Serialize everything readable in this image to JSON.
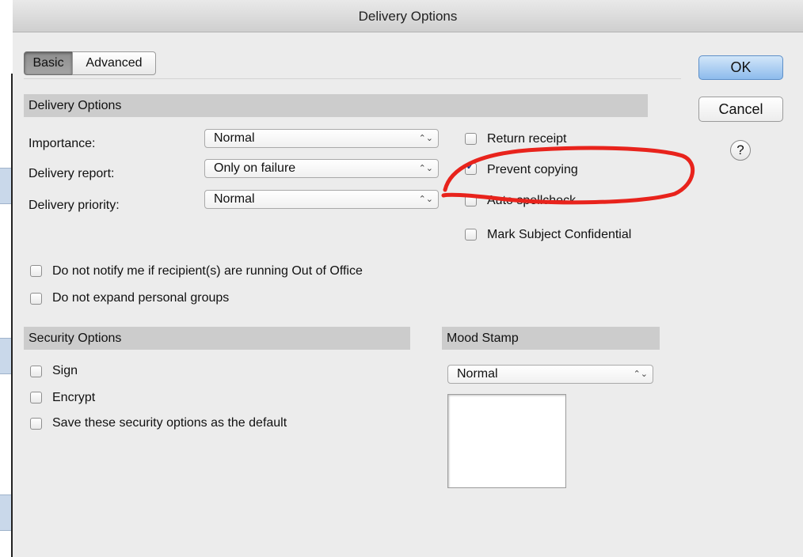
{
  "window": {
    "title": "Delivery Options"
  },
  "tabs": [
    {
      "label": "Basic",
      "selected": true
    },
    {
      "label": "Advanced",
      "selected": false
    }
  ],
  "buttons": {
    "ok": "OK",
    "cancel": "Cancel",
    "help": "?"
  },
  "delivery_section": {
    "header": "Delivery Options",
    "importance_label": "Importance:",
    "importance_value": "Normal",
    "report_label": "Delivery report:",
    "report_value": "Only on failure",
    "priority_label": "Delivery priority:",
    "priority_value": "Normal",
    "popup_arrows": "⌃⌄"
  },
  "right_checks": [
    {
      "label": "Return receipt",
      "checked": false
    },
    {
      "label": "Prevent copying",
      "checked": true
    },
    {
      "label": "Auto spellcheck",
      "checked": false
    },
    {
      "label": "Mark Subject Confidential",
      "checked": false
    }
  ],
  "wide_checks": [
    {
      "label": "Do not notify me if recipient(s) are running Out of Office",
      "checked": false
    },
    {
      "label": "Do not expand personal groups",
      "checked": false
    }
  ],
  "security_section": {
    "header": "Security Options",
    "items": [
      {
        "label": "Sign",
        "checked": false
      },
      {
        "label": "Encrypt",
        "checked": false
      },
      {
        "label": "Save these security options as the default",
        "checked": false
      }
    ]
  },
  "mood_section": {
    "header": "Mood Stamp",
    "value": "Normal"
  },
  "annotation": {
    "color": "#e8231c"
  },
  "check_glyph": "✓"
}
